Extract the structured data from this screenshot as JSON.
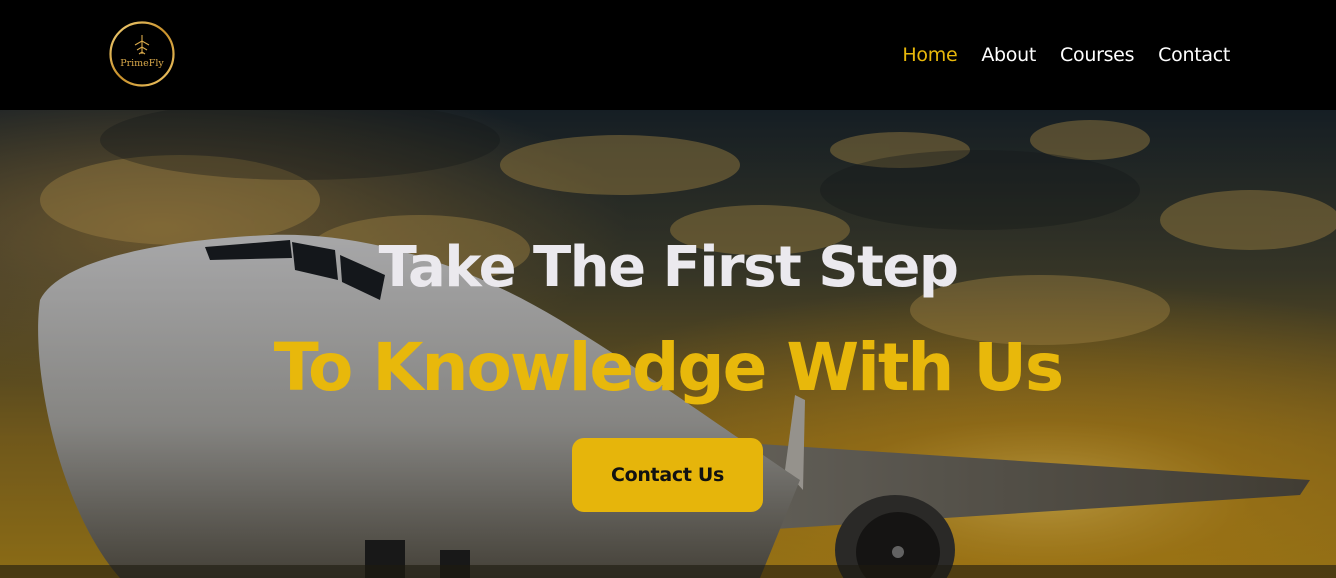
{
  "brand": {
    "logo_text": "PrimeFly",
    "logo_icon": "plane-emblem-icon",
    "accent_color": "#e8b80b"
  },
  "nav": {
    "items": [
      {
        "label": "Home",
        "active": true
      },
      {
        "label": "About",
        "active": false
      },
      {
        "label": "Courses",
        "active": false
      },
      {
        "label": "Contact",
        "active": false
      }
    ]
  },
  "hero": {
    "background": "airplane at sunset",
    "headline_line1": "Take The First Step",
    "headline_line2": "To Knowledge With Us",
    "cta_label": "Contact Us"
  }
}
